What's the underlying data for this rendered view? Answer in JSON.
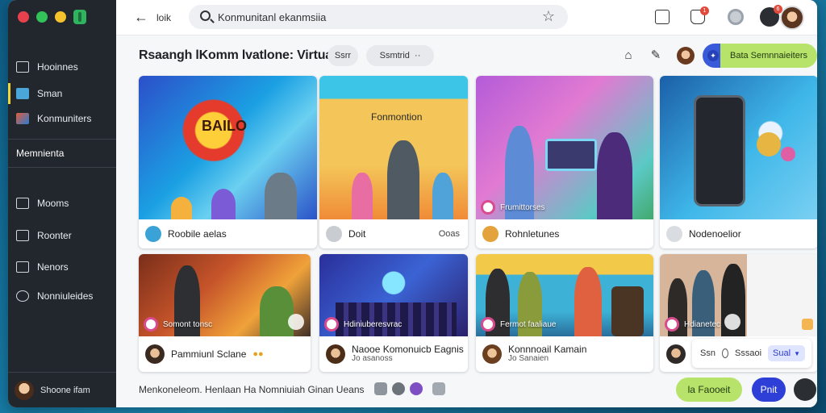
{
  "sidebar": {
    "items": [
      {
        "label": "Hooinnes"
      },
      {
        "label": "Sman"
      },
      {
        "label": "Konmuniters"
      },
      {
        "label": "Mooms"
      },
      {
        "label": "Roonter"
      },
      {
        "label": "Nenors"
      },
      {
        "label": "Nonniuleides"
      }
    ],
    "section_label": "Memnienta",
    "user_name": "Shoone ifam"
  },
  "topbar": {
    "back_label": "loik",
    "search_value": "Konmunitanl ekanmsiia",
    "notif_count": "1",
    "alert_count": "6"
  },
  "header": {
    "title": "Rsaangh lKomm lvatlone: Virtua",
    "chip1": "Ssrr",
    "chip2": "Ssmtrid",
    "cta_label": "Bata Semnnaieiters"
  },
  "cards_row1": [
    {
      "caption": "Roobile aelas",
      "art_text": "BAILO"
    },
    {
      "caption": "Doit",
      "right": "Ooas",
      "art_text": "Fonmontion"
    },
    {
      "caption": "Rohnletunes",
      "overlay": "Frumittorses"
    },
    {
      "caption": "Nodenoelior"
    }
  ],
  "cards_row2": [
    {
      "caption": "Pammiunl Sclane",
      "overlay": "Somont tonsc"
    },
    {
      "caption": "Naooe Komonuicb Eagnis",
      "sub": "Jo asanoss",
      "overlay": "Hdiniuberesvrac"
    },
    {
      "caption": "Konnnoail Kamain",
      "sub": "Jo Sanaien",
      "overlay": "Fermot faaliaue"
    },
    {
      "overlay": "Hdianetec"
    }
  ],
  "mini_panel": {
    "label": "Ssn",
    "value": "Sssaoi",
    "select": "Sual"
  },
  "footer": {
    "text": "Menkoneleom. Henlaan Ha Nomniuiah Ginan Ueans",
    "primary_btn": "la Faooeit",
    "secondary_btn": "Pnit"
  },
  "colors": {
    "accent_green": "#b7e36a",
    "accent_blue": "#3a5bd9",
    "sidebar_bg": "#22272d",
    "active_marker": "#f2d338"
  }
}
